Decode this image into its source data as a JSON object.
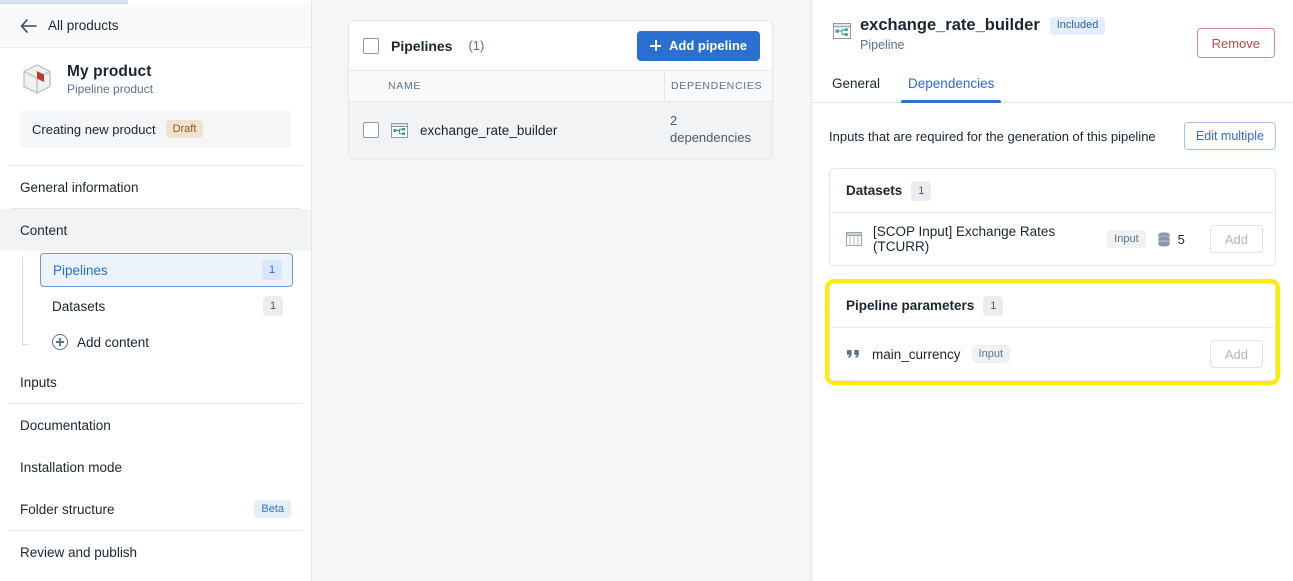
{
  "sidebar": {
    "back_label": "All products",
    "product": {
      "name": "My product",
      "subtitle": "Pipeline product",
      "icon": "product-box-icon"
    },
    "status": {
      "text": "Creating new product",
      "badge": "Draft"
    },
    "nav": [
      {
        "label": "General information"
      },
      {
        "label": "Content"
      },
      {
        "label": "Inputs"
      },
      {
        "label": "Documentation"
      },
      {
        "label": "Installation mode"
      },
      {
        "label": "Folder structure",
        "badge": "Beta"
      },
      {
        "label": "Review and publish"
      }
    ],
    "content_children": [
      {
        "label": "Pipelines",
        "count": "1",
        "selected": true
      },
      {
        "label": "Datasets",
        "count": "1",
        "selected": false
      }
    ],
    "add_content_label": "Add content"
  },
  "center": {
    "card_title": "Pipelines",
    "card_count": "(1)",
    "add_button_label": "Add pipeline",
    "columns": [
      "NAME",
      "DEPENDENCIES"
    ],
    "rows": [
      {
        "name": "exchange_rate_builder",
        "dependencies_count": "2",
        "dependencies_word": "dependencies",
        "icon": "pipeline-icon"
      }
    ]
  },
  "right": {
    "title": "exchange_rate_builder",
    "badge": "Included",
    "subtitle": "Pipeline",
    "remove_label": "Remove",
    "tabs": [
      {
        "label": "General",
        "active": false
      },
      {
        "label": "Dependencies",
        "active": true
      }
    ],
    "inputs_description": "Inputs that are required for the generation of this pipeline",
    "edit_multiple_label": "Edit multiple",
    "datasets_group": {
      "title": "Datasets",
      "count": "1",
      "items": [
        {
          "label": "[SCOP Input] Exchange Rates (TCURR)",
          "tag": "Input",
          "db_count": "5",
          "action_label": "Add",
          "icon": "dataset-table-icon"
        }
      ]
    },
    "parameters_group": {
      "title": "Pipeline parameters",
      "count": "1",
      "highlighted": true,
      "items": [
        {
          "label": "main_currency",
          "tag": "Input",
          "action_label": "Add",
          "icon": "quote-icon"
        }
      ]
    }
  },
  "colors": {
    "primary": "#2b6fd1",
    "highlight": "#ffed00",
    "danger": "#bb4a4a",
    "panel_bg": "#f5f6f7"
  }
}
